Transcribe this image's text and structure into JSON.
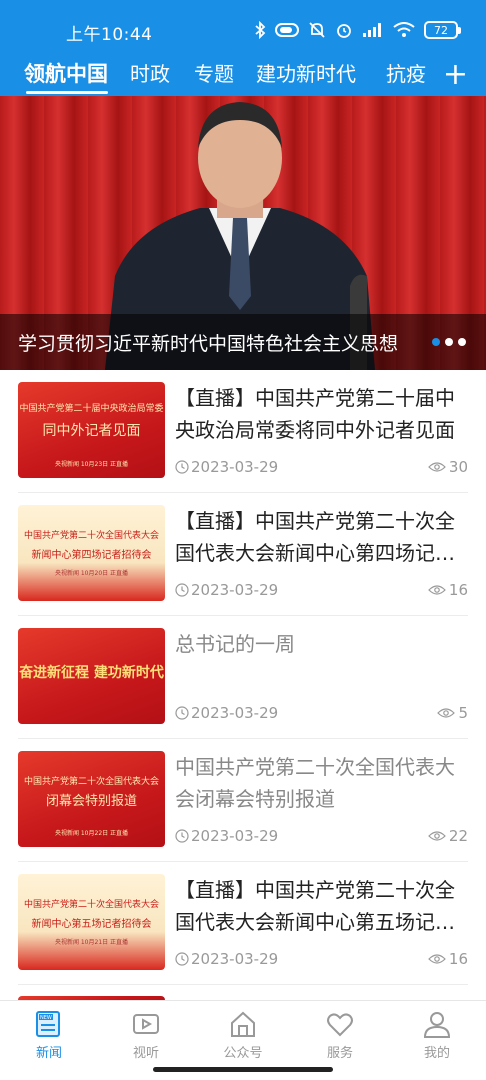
{
  "status_bar": {
    "time": "上午10:44",
    "battery": "72",
    "icons": [
      "bluetooth-icon",
      "vpn-icon",
      "mute-icon",
      "alarm-icon",
      "signal-icon",
      "wifi-icon",
      "battery-icon"
    ]
  },
  "tabs": [
    {
      "label": "领航中国",
      "active": true
    },
    {
      "label": "时政",
      "active": false
    },
    {
      "label": "专题",
      "active": false
    },
    {
      "label": "建功新时代",
      "active": false
    },
    {
      "label": "抗疫",
      "active": false
    }
  ],
  "add_tab": "+",
  "banner": {
    "title": "学习贯彻习近平新时代中国特色社会主义思想",
    "dots": 3,
    "active_dot": 1
  },
  "news": [
    {
      "title": "【直播】中国共产党第二十届中央政治局常委将同中外记者见面",
      "date": "2023-03-29",
      "views": "30",
      "read": false,
      "thumb": {
        "style": "red",
        "line1": "中国共产党第二十届中央政治局常委",
        "line2": "同中外记者见面",
        "foot": "央视新闻  10月23日  正直播"
      }
    },
    {
      "title": "【直播】中国共产党第二十次全国代表大会新闻中心第四场记者招待会",
      "date": "2023-03-29",
      "views": "16",
      "read": false,
      "thumb": {
        "style": "cream",
        "line1": "中国共产党第二十次全国代表大会",
        "line2": "新闻中心第四场记者招待会",
        "foot": "央视新闻  10月20日  正直播"
      }
    },
    {
      "title": "总书记的一周",
      "date": "2023-03-29",
      "views": "5",
      "read": true,
      "thumb": {
        "style": "red",
        "line1": "",
        "line2": "奋进新征程  建功新时代",
        "foot": ""
      }
    },
    {
      "title": "中国共产党第二十次全国代表大会闭幕会特别报道",
      "date": "2023-03-29",
      "views": "22",
      "read": true,
      "thumb": {
        "style": "red",
        "line1": "中国共产党第二十次全国代表大会",
        "line2": "闭幕会特别报道",
        "foot": "央视新闻  10月22日  正直播"
      }
    },
    {
      "title": "【直播】中国共产党第二十次全国代表大会新闻中心第五场记者招待会",
      "date": "2023-03-29",
      "views": "16",
      "read": false,
      "thumb": {
        "style": "cream",
        "line1": "中国共产党第二十次全国代表大会",
        "line2": "新闻中心第五场记者招待会",
        "foot": "央视新闻  10月21日  正直播"
      }
    }
  ],
  "bottom_nav": [
    {
      "label": "新闻",
      "icon": "news-icon",
      "active": true
    },
    {
      "label": "视听",
      "icon": "video-icon",
      "active": false
    },
    {
      "label": "公众号",
      "icon": "home-icon",
      "active": false
    },
    {
      "label": "服务",
      "icon": "heart-icon",
      "active": false
    },
    {
      "label": "我的",
      "icon": "user-icon",
      "active": false
    }
  ],
  "colors": {
    "brand": "#1a8fe6",
    "banner_red": "#c92424",
    "text": "#222222",
    "muted": "#999999"
  }
}
